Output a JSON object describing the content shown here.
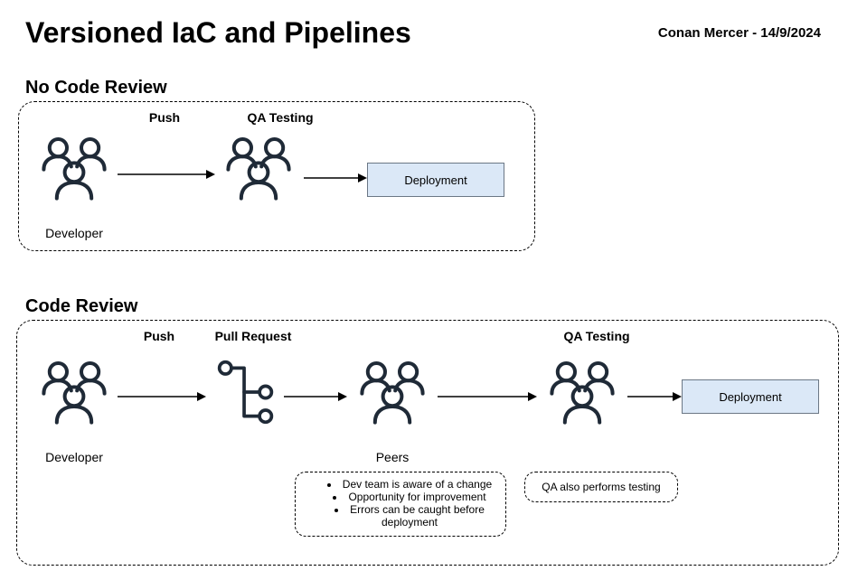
{
  "header": {
    "title": "Versioned IaC and Pipelines",
    "byline": "Conan Mercer - 14/9/2024"
  },
  "section1": {
    "title": "No Code Review",
    "labels": {
      "push": "Push",
      "qa": "QA Testing",
      "dev_caption": "Developer",
      "deploy": "Deployment"
    }
  },
  "section2": {
    "title": "Code Review",
    "labels": {
      "push": "Push",
      "pr": "Pull Request",
      "qa": "QA Testing",
      "dev_caption": "Developer",
      "peers_caption": "Peers",
      "deploy": "Deployment"
    },
    "notes": {
      "peer_bullets": [
        "Dev team is aware of a change",
        "Opportunity for improvement",
        "Errors can be caught before deployment"
      ],
      "qa_note": "QA also performs testing"
    }
  }
}
